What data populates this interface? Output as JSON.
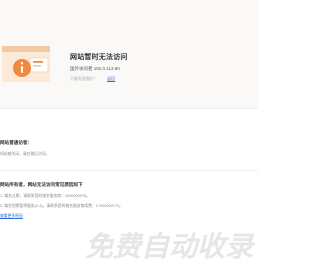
{
  "header": {
    "title": "网站暂时无法访问",
    "ip_label": "国外访问者",
    "ip_value": "192.0.113.60",
    "meta_label": "不要失败图片：",
    "meta_link": "返回"
  },
  "section1": {
    "title": "网站普通访客：",
    "line1": "如站被关闭，请在稍后访问。"
  },
  "section2": {
    "title": "网站所有者，网站无法访问常见原因如下",
    "line1": "1. 域名过期，请联系您的域名服务商：2000000978。",
    "line2": "2. 域名到期暂停服务(2-4)，请联系您的域名服务商续费：17000009773。",
    "link": "查看更多原因"
  },
  "watermark": {
    "text": "免费自动收录"
  },
  "colors": {
    "accent": "#f08a3c",
    "link": "#2a6ad6",
    "watermark": "#e6e6e6"
  }
}
